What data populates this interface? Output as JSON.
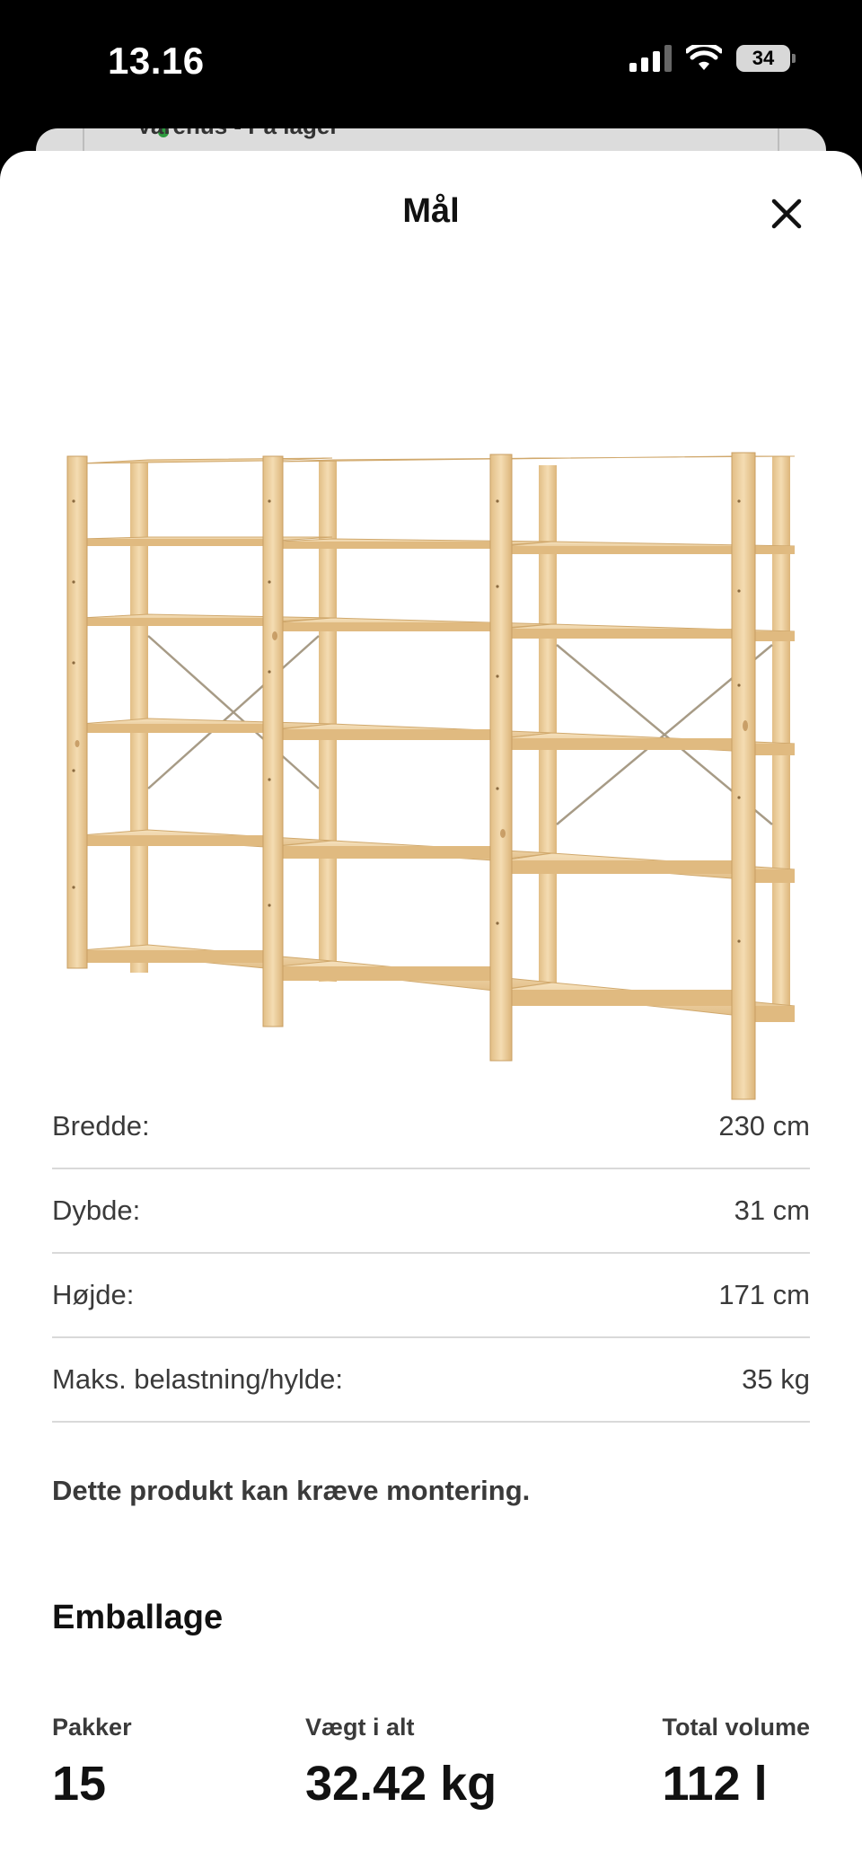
{
  "status_bar": {
    "time": "13.16",
    "battery": "34",
    "icons": [
      "cellular-signal-icon",
      "wifi-icon",
      "battery-icon"
    ]
  },
  "background_sheet": {
    "text": "Varehus - På lager"
  },
  "sheet": {
    "title": "Mål",
    "close_icon": "close-icon"
  },
  "product_image": {
    "description_icon": "wooden-shelving-unit-image"
  },
  "dimensions": [
    {
      "label": "Bredde:",
      "value": "230 cm"
    },
    {
      "label": "Dybde:",
      "value": "31 cm"
    },
    {
      "label": "Højde:",
      "value": "171 cm"
    },
    {
      "label": "Maks. belastning/hylde:",
      "value": "35 kg"
    }
  ],
  "assembly_note": "Dette produkt kan kræve montering.",
  "packaging": {
    "title": "Emballage",
    "items": [
      {
        "label": "Pakker",
        "value": "15"
      },
      {
        "label": "Vægt i alt",
        "value": "32.42 kg"
      },
      {
        "label": "Total volume",
        "value": "112 l"
      }
    ]
  },
  "colors": {
    "background": "#000000",
    "sheet": "#ffffff",
    "wood_light": "#f1d6a8",
    "wood_mid": "#e6c48d",
    "wood_dark": "#d3aa6c",
    "divider": "#d9d9d9",
    "stock_green": "#2d9a3f"
  }
}
